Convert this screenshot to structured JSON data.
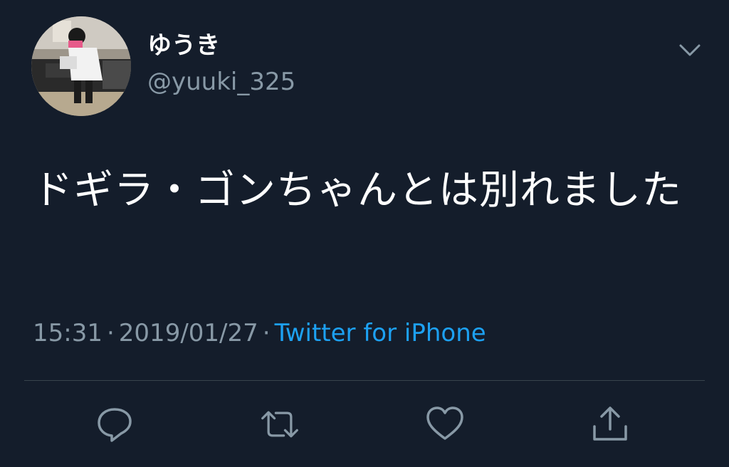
{
  "tweet": {
    "display_name": "ゆうき",
    "handle": "@yuuki_325",
    "text": "ドギラ・ゴンちゃんとは別れました",
    "time": "15:31",
    "date": "2019/01/27",
    "separator": "·",
    "source": "Twitter for iPhone"
  },
  "icons": {
    "menu": "chevron-down-icon",
    "reply": "reply-icon",
    "retweet": "retweet-icon",
    "like": "heart-icon",
    "share": "share-icon"
  },
  "colors": {
    "background": "#141d2b",
    "primary_text": "#ffffff",
    "secondary_text": "#8899a6",
    "link": "#1da1f2",
    "divider": "#38444d"
  }
}
